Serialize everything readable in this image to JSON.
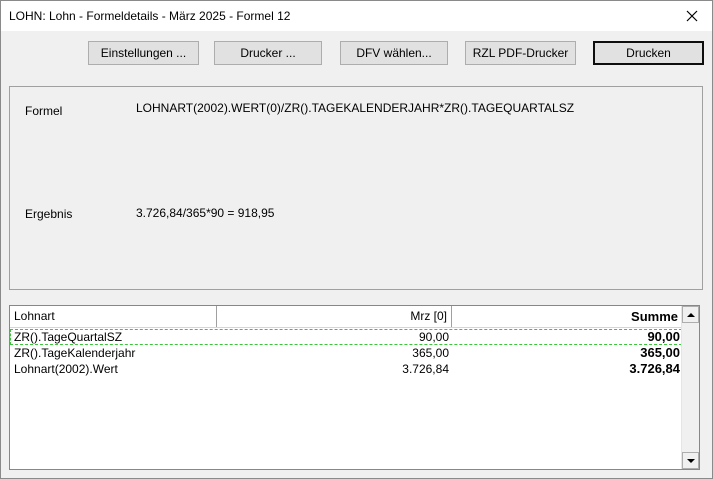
{
  "window": {
    "title": "LOHN: Lohn - Formeldetails - März 2025 - Formel 12",
    "close_icon": "close-icon"
  },
  "toolbar": {
    "settings_label": "Einstellungen ...",
    "printer_label": "Drucker ...",
    "dfv_label": "DFV wählen...",
    "rzl_label": "RZL PDF-Drucker",
    "print_label": "Drucken"
  },
  "details": {
    "formula_label": "Formel",
    "formula_value": "LOHNART(2002).WERT(0)/ZR().TAGEKALENDERJAHR*ZR().TAGEQUARTALSZ",
    "result_label": "Ergebnis",
    "result_value": "3.726,84/365*90 = 918,95"
  },
  "table": {
    "columns": [
      "Lohnart",
      "Mrz [0]",
      "Summe"
    ],
    "rows": [
      {
        "lohnart": "ZR().TageQuartalSZ",
        "mrz": "90,00",
        "summe": "90,00"
      },
      {
        "lohnart": "ZR().TageKalenderjahr",
        "mrz": "365,00",
        "summe": "365,00"
      },
      {
        "lohnart": "Lohnart(2002).Wert",
        "mrz": "3.726,84",
        "summe": "3.726,84"
      }
    ]
  }
}
